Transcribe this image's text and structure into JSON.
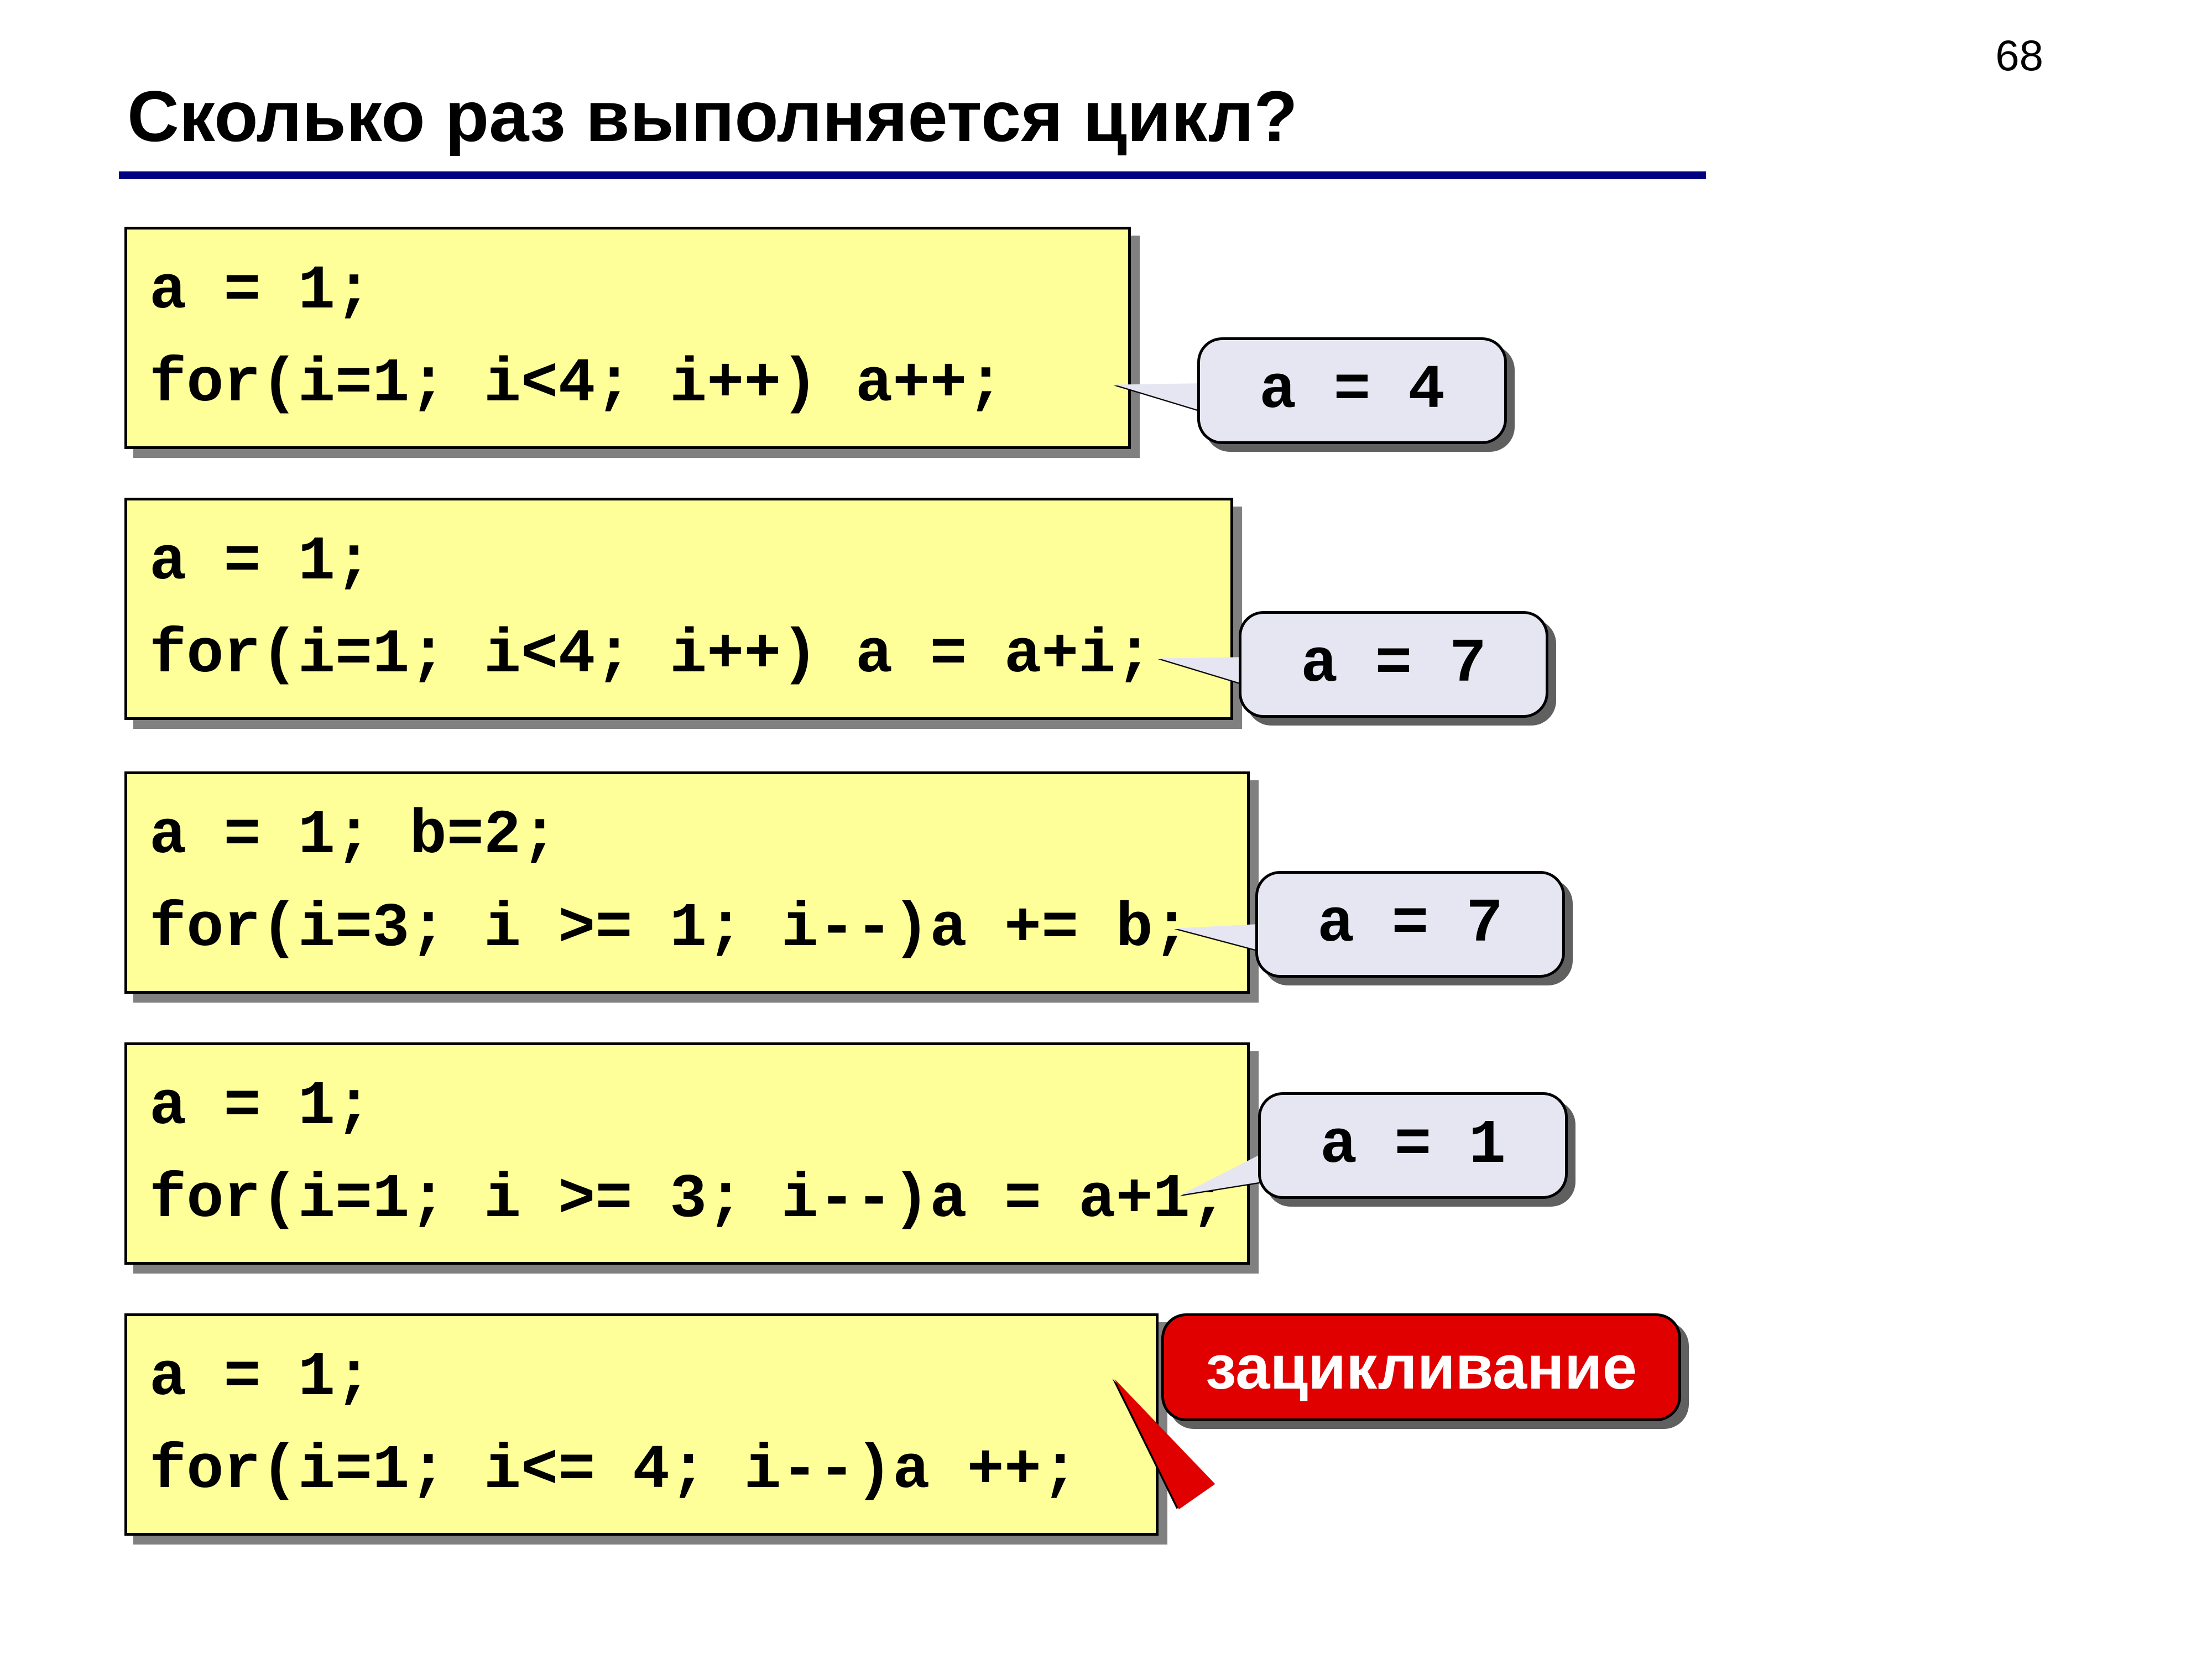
{
  "page_number": "68",
  "title": "Сколько раз выполняется цикл?",
  "blocks": [
    {
      "code": "a = 1;\nfor(i=1; i<4; i++) a++;",
      "answer": "a = 4"
    },
    {
      "code": "a = 1;\nfor(i=1; i<4; i++) a = a+i;",
      "answer": "a = 7"
    },
    {
      "code": "a = 1; b=2;\nfor(i=3; i >= 1; i--)a += b;",
      "answer": "a = 7"
    },
    {
      "code": "a = 1;\nfor(i=1; i >= 3; i--)a = a+1;",
      "answer": "a = 1"
    },
    {
      "code": "a = 1;\nfor(i=1; i<= 4; i--)a ++;",
      "answer": "зацикливание",
      "answer_style": "red"
    }
  ]
}
